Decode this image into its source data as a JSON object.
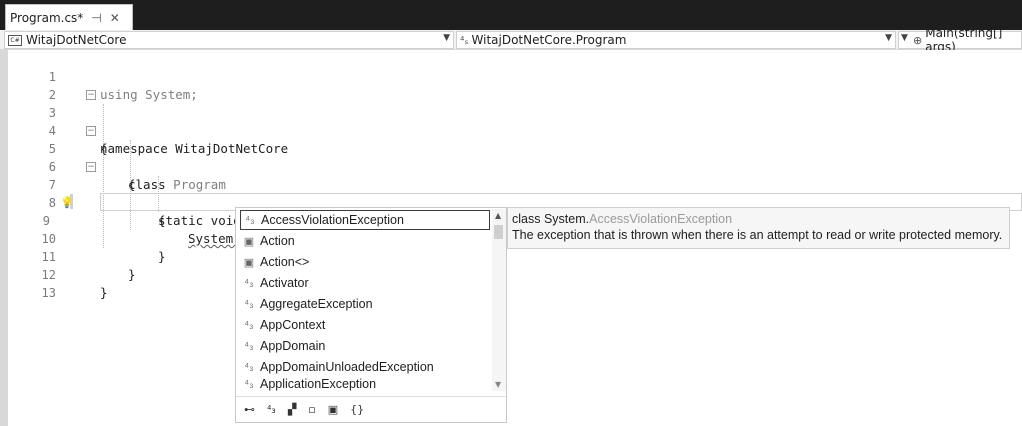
{
  "tab": {
    "label": "Program.cs*",
    "pin_icon": "pin-icon",
    "close_icon": "close-icon",
    "pin_glyph": "⊣",
    "close_glyph": "✕"
  },
  "navbar": {
    "project": "WitajDotNetCore",
    "type": "WitajDotNetCore.Program",
    "member": "Main(string[] args)"
  },
  "code": {
    "lines": [
      {
        "n": "1",
        "text": "using System;"
      },
      {
        "n": "2",
        "text": ""
      },
      {
        "n": "3",
        "text": "namespace WitajDotNetCore"
      },
      {
        "n": "4",
        "text": "{"
      },
      {
        "n": "5",
        "kw": "class",
        "name": "Program"
      },
      {
        "n": "6",
        "text": "{"
      },
      {
        "n": "7",
        "text": "static void Main(string[] args)"
      },
      {
        "n": "8",
        "text": "{"
      },
      {
        "n": "9",
        "text": "System."
      },
      {
        "n": "10",
        "text": "}"
      },
      {
        "n": "11",
        "text": "}"
      },
      {
        "n": "12",
        "text": "}"
      },
      {
        "n": "13",
        "text": ""
      }
    ]
  },
  "completion": {
    "items": [
      {
        "label": "AccessViolationException",
        "icon": "class-icon",
        "selected": true
      },
      {
        "label": "Action",
        "icon": "delegate-icon"
      },
      {
        "label": "Action<>",
        "icon": "delegate-icon"
      },
      {
        "label": "Activator",
        "icon": "class-icon"
      },
      {
        "label": "AggregateException",
        "icon": "class-icon"
      },
      {
        "label": "AppContext",
        "icon": "class-icon"
      },
      {
        "label": "AppDomain",
        "icon": "class-icon"
      },
      {
        "label": "AppDomainUnloadedException",
        "icon": "class-icon"
      },
      {
        "label": "ApplicationException",
        "icon": "class-icon"
      }
    ],
    "filters": [
      "⊷",
      "⁴₃",
      "▞",
      "▫",
      "▣",
      "{}"
    ]
  },
  "tooltip": {
    "prefix": "class System.",
    "type": "AccessViolationException",
    "description": "The exception that is thrown when there is an attempt to read or write protected memory."
  }
}
